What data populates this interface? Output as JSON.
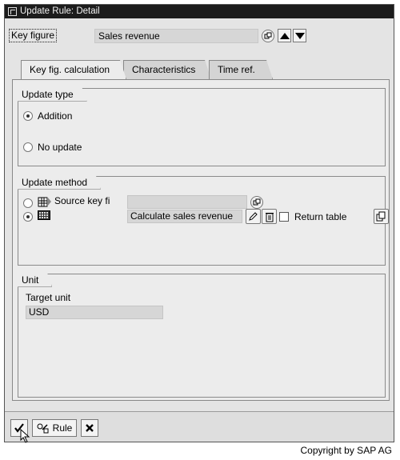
{
  "window": {
    "title": "Update Rule: Detail"
  },
  "key_figure": {
    "label": "Key figure",
    "value": "Sales revenue"
  },
  "tabs": [
    {
      "label": "Key fig. calculation",
      "active": true
    },
    {
      "label": "Characteristics",
      "active": false
    },
    {
      "label": "Time ref.",
      "active": false
    }
  ],
  "update_type": {
    "title": "Update type",
    "options": [
      {
        "label": "Addition",
        "selected": true
      },
      {
        "label": "No update",
        "selected": false
      }
    ]
  },
  "update_method": {
    "title": "Update method",
    "source_label": "Source key fi",
    "source_value": "",
    "routine_value": "Calculate sales revenue",
    "return_table_label": "Return table"
  },
  "unit": {
    "title": "Unit",
    "target_label": "Target unit",
    "target_value": "USD"
  },
  "footer": {
    "rule_label": "Rule"
  },
  "copyright": "Copyright by SAP AG"
}
